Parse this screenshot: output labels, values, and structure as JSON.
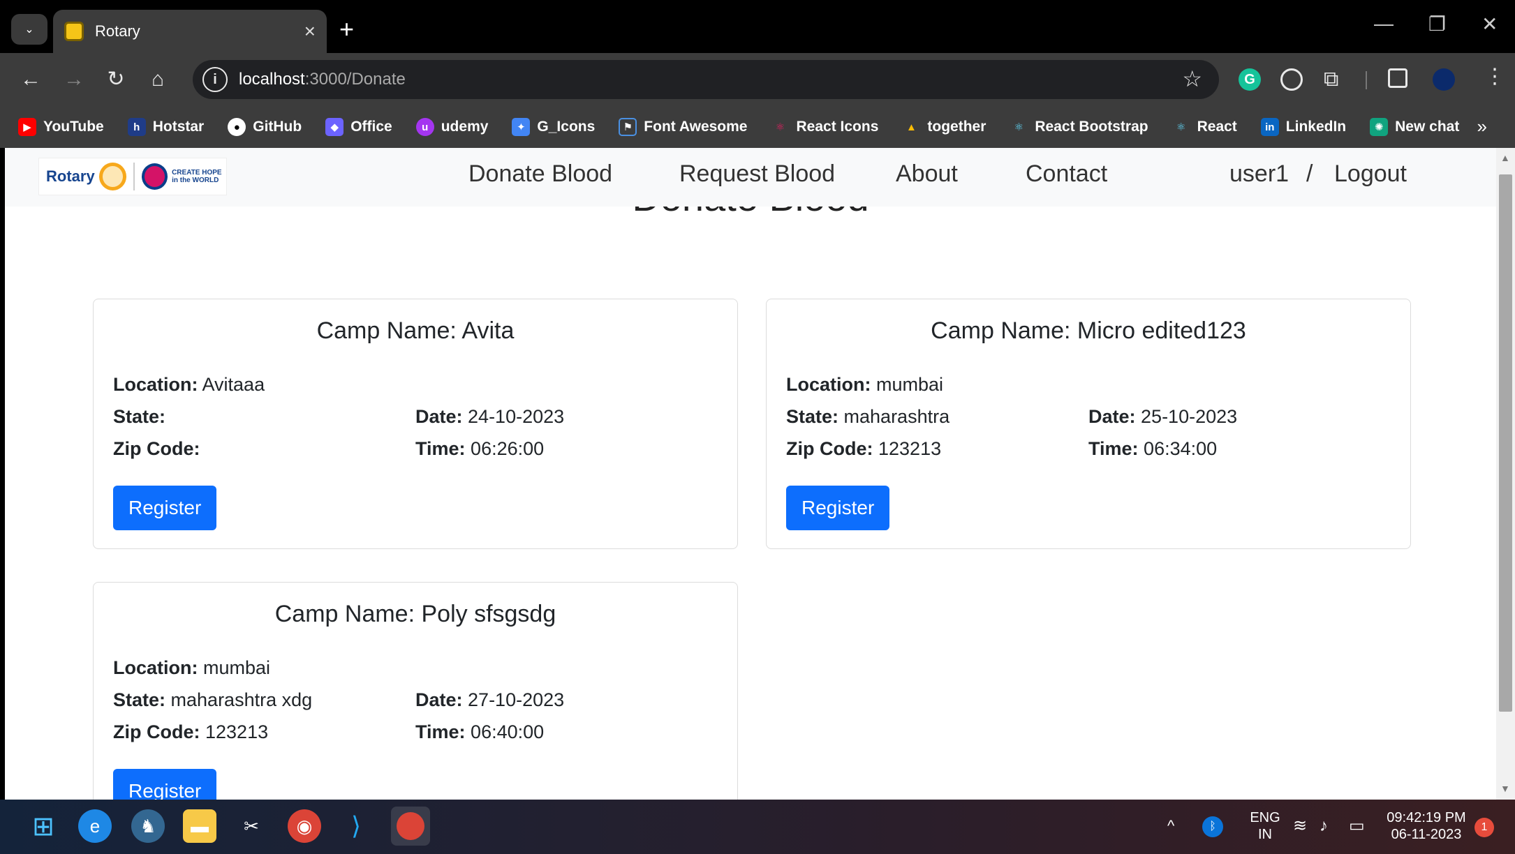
{
  "browser": {
    "tab_title": "Rotary",
    "close_glyph": "×",
    "new_tab_glyph": "+",
    "url_host": "localhost",
    "url_path": ":3000/Donate",
    "bookmarks": [
      "YouTube",
      "Hotstar",
      "GitHub",
      "Office",
      "udemy",
      "G_Icons",
      "Font Awesome",
      "React Icons",
      "together",
      "React Bootstrap",
      "React",
      "LinkedIn",
      "New chat"
    ],
    "bookmark_more": "»"
  },
  "site": {
    "logo_word": "Rotary",
    "logo_tagline": "CREATE HOPE in the WORLD",
    "nav": {
      "donate": "Donate Blood",
      "request": "Request Blood",
      "about": "About",
      "contact": "Contact",
      "user": "user1",
      "separator": "/",
      "logout": "Logout"
    },
    "page_title": "Donate Blood"
  },
  "labels": {
    "location": "Location:",
    "state": "State:",
    "zip": "Zip Code:",
    "date": "Date:",
    "time": "Time:",
    "register": "Register"
  },
  "camps": [
    {
      "title": "Camp Name: Avita",
      "location": "Avitaaa",
      "state": "",
      "zip": "",
      "date": "24-10-2023",
      "time": "06:26:00"
    },
    {
      "title": "Camp Name: Micro edited123",
      "location": "mumbai",
      "state": "maharashtra",
      "zip": "123213",
      "date": "25-10-2023",
      "time": "06:34:00"
    },
    {
      "title": "Camp Name: Poly sfsgsdg",
      "location": "mumbai",
      "state": "maharashtra xdg",
      "zip": "123213",
      "date": "27-10-2023",
      "time": "06:40:00"
    }
  ],
  "taskbar": {
    "lang_line1": "ENG",
    "lang_line2": "IN",
    "time": "09:42:19 PM",
    "date": "06-11-2023",
    "notifications": "1"
  },
  "colors": {
    "primary": "#0d6efd",
    "navbar_bg": "#f8f9fa",
    "chrome_dark": "#3c3c3c"
  }
}
